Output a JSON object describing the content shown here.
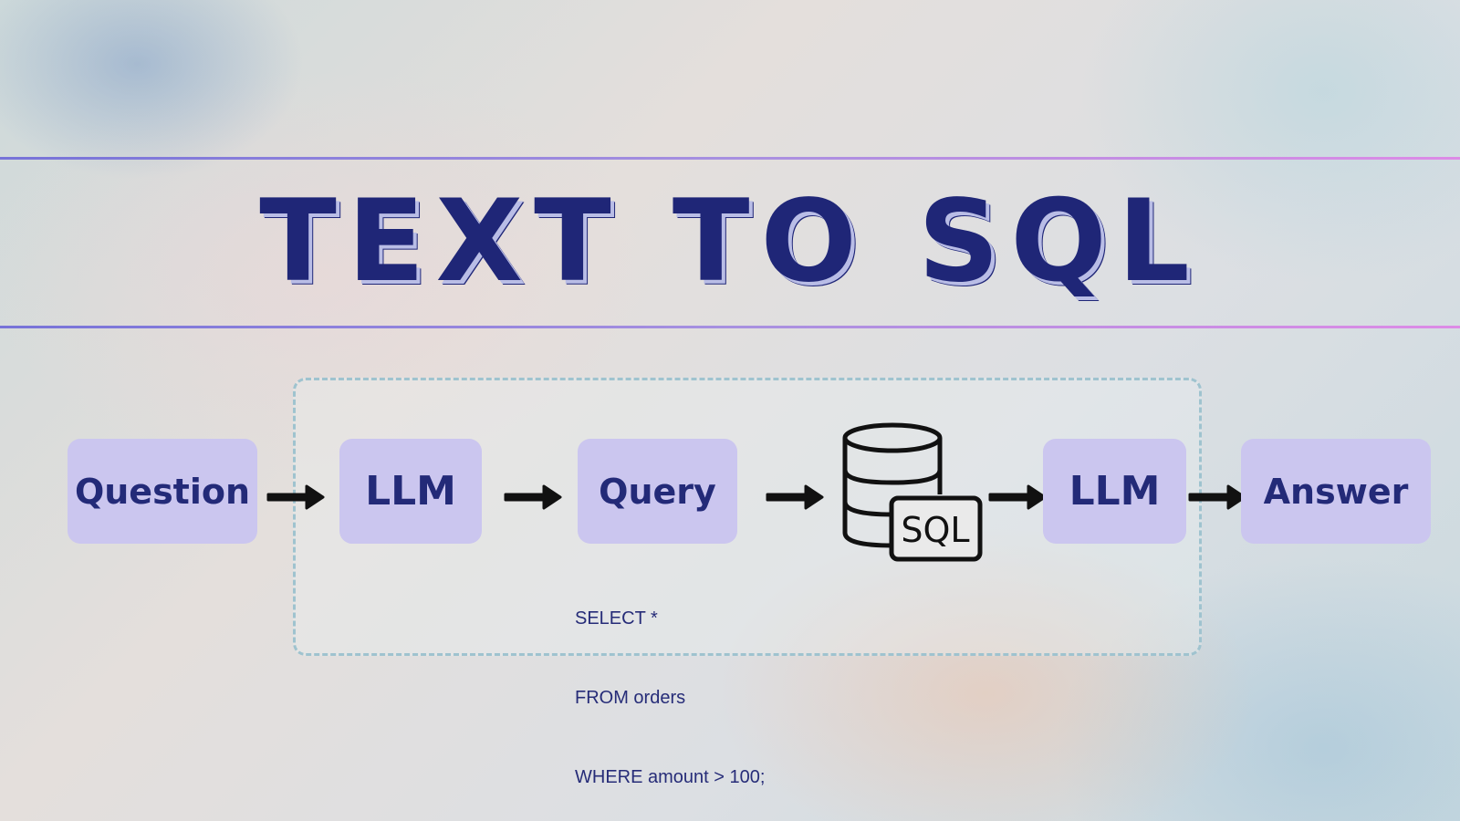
{
  "title": "TEXT TO SQL",
  "flow": {
    "question_label": "Question",
    "llm_first_label": "LLM",
    "query_label": "Query",
    "database_badge": "SQL",
    "llm_second_label": "LLM",
    "answer_label": "Answer"
  },
  "query_example": {
    "lines": [
      "SELECT *",
      "FROM orders",
      "WHERE amount > 100;"
    ]
  },
  "colors": {
    "title": "#1f2677",
    "box_fill": "#cbc6ef",
    "box_text": "#232a78",
    "dashed_border": "#9fc3cf",
    "rule_start": "#7773d8",
    "rule_end": "#dd8be6",
    "arrow": "#111111"
  }
}
